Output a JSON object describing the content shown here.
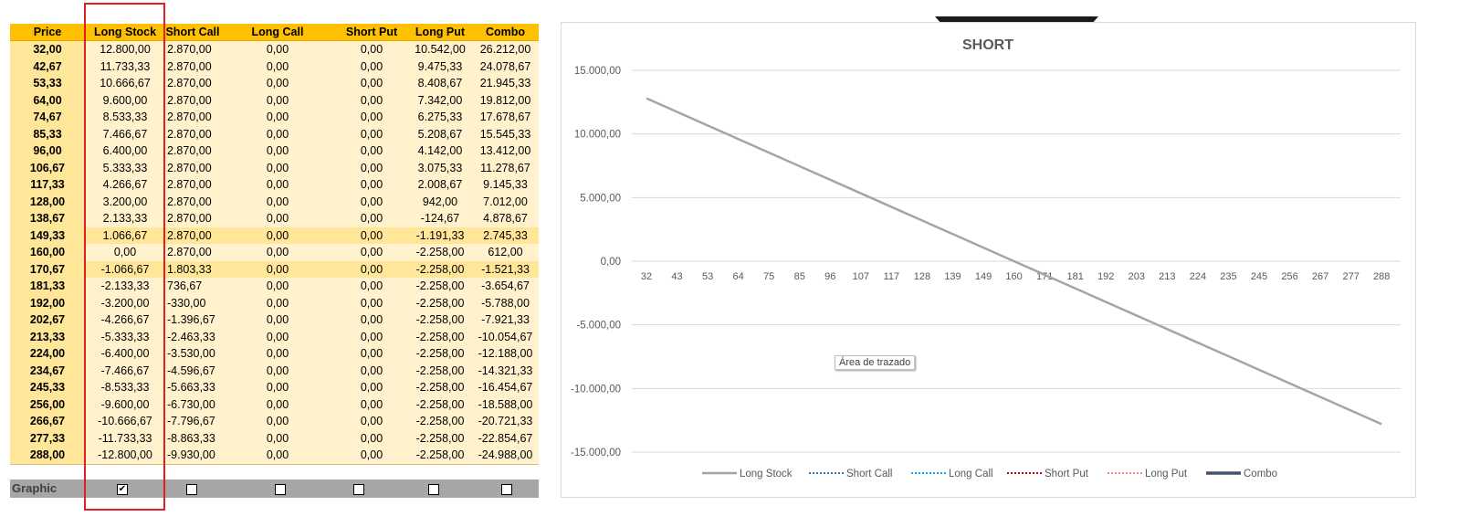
{
  "table": {
    "headers": [
      "Price",
      "Long Stock",
      "Short Call",
      "Long Call",
      "Short Put",
      "Long Put",
      "Combo"
    ],
    "rows": [
      [
        "32,00",
        "12.800,00",
        "2.870,00",
        "0,00",
        "0,00",
        "10.542,00",
        "26.212,00"
      ],
      [
        "42,67",
        "11.733,33",
        "2.870,00",
        "0,00",
        "0,00",
        "9.475,33",
        "24.078,67"
      ],
      [
        "53,33",
        "10.666,67",
        "2.870,00",
        "0,00",
        "0,00",
        "8.408,67",
        "21.945,33"
      ],
      [
        "64,00",
        "9.600,00",
        "2.870,00",
        "0,00",
        "0,00",
        "7.342,00",
        "19.812,00"
      ],
      [
        "74,67",
        "8.533,33",
        "2.870,00",
        "0,00",
        "0,00",
        "6.275,33",
        "17.678,67"
      ],
      [
        "85,33",
        "7.466,67",
        "2.870,00",
        "0,00",
        "0,00",
        "5.208,67",
        "15.545,33"
      ],
      [
        "96,00",
        "6.400,00",
        "2.870,00",
        "0,00",
        "0,00",
        "4.142,00",
        "13.412,00"
      ],
      [
        "106,67",
        "5.333,33",
        "2.870,00",
        "0,00",
        "0,00",
        "3.075,33",
        "11.278,67"
      ],
      [
        "117,33",
        "4.266,67",
        "2.870,00",
        "0,00",
        "0,00",
        "2.008,67",
        "9.145,33"
      ],
      [
        "128,00",
        "3.200,00",
        "2.870,00",
        "0,00",
        "0,00",
        "942,00",
        "7.012,00"
      ],
      [
        "138,67",
        "2.133,33",
        "2.870,00",
        "0,00",
        "0,00",
        "-124,67",
        "4.878,67"
      ],
      [
        "149,33",
        "1.066,67",
        "2.870,00",
        "0,00",
        "0,00",
        "-1.191,33",
        "2.745,33"
      ],
      [
        "160,00",
        "0,00",
        "2.870,00",
        "0,00",
        "0,00",
        "-2.258,00",
        "612,00"
      ],
      [
        "170,67",
        "-1.066,67",
        "1.803,33",
        "0,00",
        "0,00",
        "-2.258,00",
        "-1.521,33"
      ],
      [
        "181,33",
        "-2.133,33",
        "736,67",
        "0,00",
        "0,00",
        "-2.258,00",
        "-3.654,67"
      ],
      [
        "192,00",
        "-3.200,00",
        "-330,00",
        "0,00",
        "0,00",
        "-2.258,00",
        "-5.788,00"
      ],
      [
        "202,67",
        "-4.266,67",
        "-1.396,67",
        "0,00",
        "0,00",
        "-2.258,00",
        "-7.921,33"
      ],
      [
        "213,33",
        "-5.333,33",
        "-2.463,33",
        "0,00",
        "0,00",
        "-2.258,00",
        "-10.054,67"
      ],
      [
        "224,00",
        "-6.400,00",
        "-3.530,00",
        "0,00",
        "0,00",
        "-2.258,00",
        "-12.188,00"
      ],
      [
        "234,67",
        "-7.466,67",
        "-4.596,67",
        "0,00",
        "0,00",
        "-2.258,00",
        "-14.321,33"
      ],
      [
        "245,33",
        "-8.533,33",
        "-5.663,33",
        "0,00",
        "0,00",
        "-2.258,00",
        "-16.454,67"
      ],
      [
        "256,00",
        "-9.600,00",
        "-6.730,00",
        "0,00",
        "0,00",
        "-2.258,00",
        "-18.588,00"
      ],
      [
        "266,67",
        "-10.666,67",
        "-7.796,67",
        "0,00",
        "0,00",
        "-2.258,00",
        "-20.721,33"
      ],
      [
        "277,33",
        "-11.733,33",
        "-8.863,33",
        "0,00",
        "0,00",
        "-2.258,00",
        "-22.854,67"
      ],
      [
        "288,00",
        "-12.800,00",
        "-9.930,00",
        "0,00",
        "0,00",
        "-2.258,00",
        "-24.988,00"
      ]
    ],
    "highlighted_rows": [
      11,
      13
    ]
  },
  "graphic": {
    "label": "Graphic",
    "checkboxes": [
      {
        "column": "Long Stock",
        "checked": true,
        "mark": "✔"
      },
      {
        "column": "Short Call",
        "checked": false,
        "mark": ""
      },
      {
        "column": "Long Call",
        "checked": false,
        "mark": ""
      },
      {
        "column": "Short Put",
        "checked": false,
        "mark": ""
      },
      {
        "column": "Long Put",
        "checked": false,
        "mark": ""
      },
      {
        "column": "Combo",
        "checked": false,
        "mark": ""
      }
    ]
  },
  "tooltip": "Área de trazado",
  "colors": {
    "header": "#ffc000",
    "price_cell": "#ffe699",
    "cell": "#fff2cc",
    "highlight_box": "#e02020"
  },
  "chart_data": {
    "type": "line",
    "title": "SHORT",
    "xlabel": "",
    "ylabel": "",
    "categories": [
      "32",
      "43",
      "53",
      "64",
      "75",
      "85",
      "96",
      "107",
      "117",
      "128",
      "139",
      "149",
      "160",
      "171",
      "181",
      "192",
      "203",
      "213",
      "224",
      "235",
      "245",
      "256",
      "267",
      "277",
      "288"
    ],
    "ylim": [
      -15000,
      15000
    ],
    "yticks": [
      "15.000,00",
      "10.000,00",
      "5.000,00",
      "0,00",
      "-5.000,00",
      "-10.000,00",
      "-15.000,00"
    ],
    "ytick_values": [
      15000,
      10000,
      5000,
      0,
      -5000,
      -10000,
      -15000
    ],
    "grid": true,
    "legend_position": "bottom",
    "series": [
      {
        "name": "Long Stock",
        "color": "#a5a5a5",
        "style": "solid",
        "visible": true,
        "values": [
          12800,
          11733.33,
          10666.67,
          9600,
          8533.33,
          7466.67,
          6400,
          5333.33,
          4266.67,
          3200,
          2133.33,
          1066.67,
          0,
          -1066.67,
          -2133.33,
          -3200,
          -4266.67,
          -5333.33,
          -6400,
          -7466.67,
          -8533.33,
          -9600,
          -10666.67,
          -11733.33,
          -12800
        ]
      },
      {
        "name": "Short Call",
        "color": "#2e75b6",
        "style": "dotted",
        "visible": false,
        "values": []
      },
      {
        "name": "Long Call",
        "color": "#00b0f0",
        "style": "dotted",
        "visible": false,
        "values": []
      },
      {
        "name": "Short Put",
        "color": "#c00000",
        "style": "dotted",
        "visible": false,
        "values": []
      },
      {
        "name": "Long Put",
        "color": "#ff7c80",
        "style": "dotted",
        "visible": false,
        "values": []
      },
      {
        "name": "Combo",
        "color": "#44546a",
        "style": "solid-thick",
        "visible": false,
        "values": []
      }
    ]
  }
}
